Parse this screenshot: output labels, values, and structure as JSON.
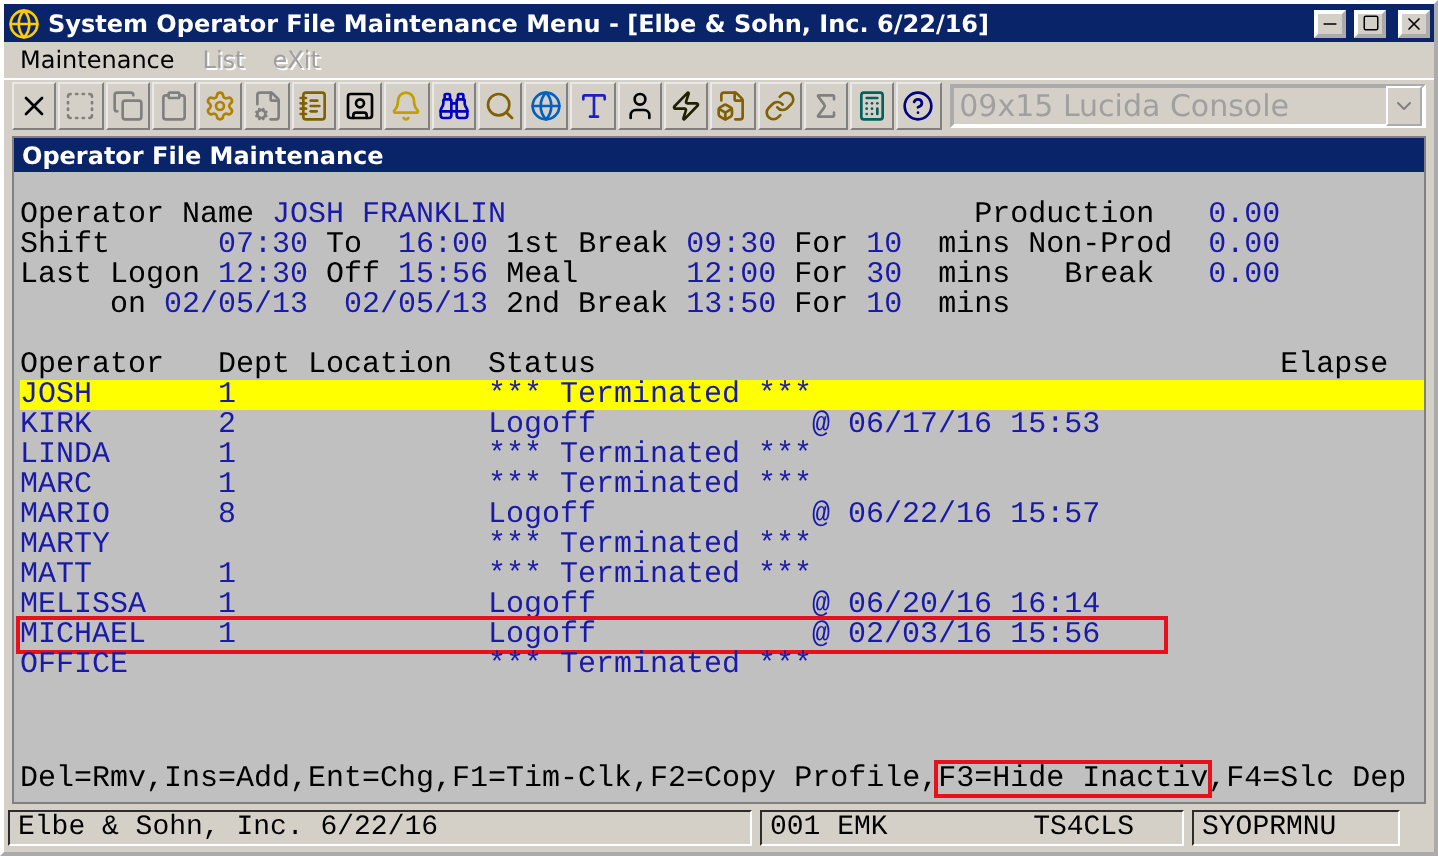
{
  "window": {
    "title": "System Operator File Maintenance Menu - [Elbe & Sohn, Inc. 6/22/16]"
  },
  "menu": [
    {
      "label": "Maintenance",
      "disabled": false
    },
    {
      "label": "List",
      "disabled": true
    },
    {
      "label": "eXit",
      "disabled": true
    }
  ],
  "toolbar": {
    "font_select": {
      "value": "09x15 Lucida Console",
      "disabled": true
    }
  },
  "panel_title": "Operator File Maintenance",
  "header_lines": [
    [
      {
        "kind": "label",
        "text": "Operator Name"
      },
      {
        "kind": "value",
        "text": "JOSH FRANKLIN"
      },
      {
        "kind": "label",
        "text": "Production"
      },
      {
        "kind": "value",
        "text": "0.00"
      }
    ],
    [
      {
        "kind": "label",
        "text": "Shift"
      },
      {
        "kind": "value",
        "text": "07:30"
      },
      {
        "kind": "label",
        "text": "To"
      },
      {
        "kind": "value",
        "text": "16:00"
      },
      {
        "kind": "label",
        "text": "1st Break"
      },
      {
        "kind": "value",
        "text": "09:30"
      },
      {
        "kind": "label",
        "text": "For"
      },
      {
        "kind": "value",
        "text": "10"
      },
      {
        "kind": "label",
        "text": "mins"
      },
      {
        "kind": "label",
        "text": "Non-Prod"
      },
      {
        "kind": "value",
        "text": "0.00"
      }
    ],
    [
      {
        "kind": "label",
        "text": "Last Logon"
      },
      {
        "kind": "value",
        "text": "12:30"
      },
      {
        "kind": "label",
        "text": "Off"
      },
      {
        "kind": "value",
        "text": "15:56"
      },
      {
        "kind": "label",
        "text": "Meal"
      },
      {
        "kind": "value",
        "text": "12:00"
      },
      {
        "kind": "label",
        "text": "For"
      },
      {
        "kind": "value",
        "text": "30"
      },
      {
        "kind": "label",
        "text": "mins"
      },
      {
        "kind": "label",
        "text": "Break"
      },
      {
        "kind": "value",
        "text": "0.00"
      }
    ],
    [
      {
        "kind": "label",
        "text": "on"
      },
      {
        "kind": "value",
        "text": "02/05/13"
      },
      {
        "kind": "value",
        "text": "02/05/13"
      },
      {
        "kind": "label",
        "text": "2nd Break"
      },
      {
        "kind": "value",
        "text": "13:50"
      },
      {
        "kind": "label",
        "text": "For"
      },
      {
        "kind": "value",
        "text": "10"
      },
      {
        "kind": "label",
        "text": "mins"
      }
    ]
  ],
  "table": {
    "columns": [
      "Operator",
      "Dept Location",
      "Status",
      "Elapse"
    ],
    "rows": [
      {
        "operator": "JOSH",
        "dept": "1",
        "status": "*** Terminated ***",
        "selected": true,
        "outlined": false
      },
      {
        "operator": "KIRK",
        "dept": "2",
        "status": "Logoff",
        "logoff": "@ 06/17/16 15:53",
        "selected": false,
        "outlined": false
      },
      {
        "operator": "LINDA",
        "dept": "1",
        "status": "*** Terminated ***",
        "selected": false,
        "outlined": false
      },
      {
        "operator": "MARC",
        "dept": "1",
        "status": "*** Terminated ***",
        "selected": false,
        "outlined": false
      },
      {
        "operator": "MARIO",
        "dept": "8",
        "status": "Logoff",
        "logoff": "@ 06/22/16 15:57",
        "selected": false,
        "outlined": false
      },
      {
        "operator": "MARTY",
        "status": "*** Terminated ***",
        "selected": false,
        "outlined": false
      },
      {
        "operator": "MATT",
        "dept": "1",
        "status": "*** Terminated ***",
        "selected": false,
        "outlined": false
      },
      {
        "operator": "MELISSA",
        "dept": "1",
        "status": "Logoff",
        "logoff": "@ 06/20/16 16:14",
        "selected": false,
        "outlined": false
      },
      {
        "operator": "MICHAEL",
        "dept": "1",
        "status": "Logoff",
        "logoff": "@ 02/03/16 15:56",
        "selected": false,
        "outlined": true
      },
      {
        "operator": "OFFICE",
        "status": "*** Terminated ***",
        "selected": false,
        "outlined": false
      }
    ]
  },
  "function_keys": [
    {
      "text": "Del=Rmv,Ins=Add,Ent=Chg,F1=Tim-Clk,F2=Copy Profile,",
      "outlined": false
    },
    {
      "text": "F3=Hide Inactiv",
      "outlined": true
    },
    {
      "text": ",F4=Slc Dep",
      "outlined": false
    }
  ],
  "status_bar": {
    "company": "Elbe & Sohn, Inc. 6/22/16",
    "user": "001 EMK",
    "terminal": "TS4CLS",
    "program": "SYOPRMNU"
  }
}
